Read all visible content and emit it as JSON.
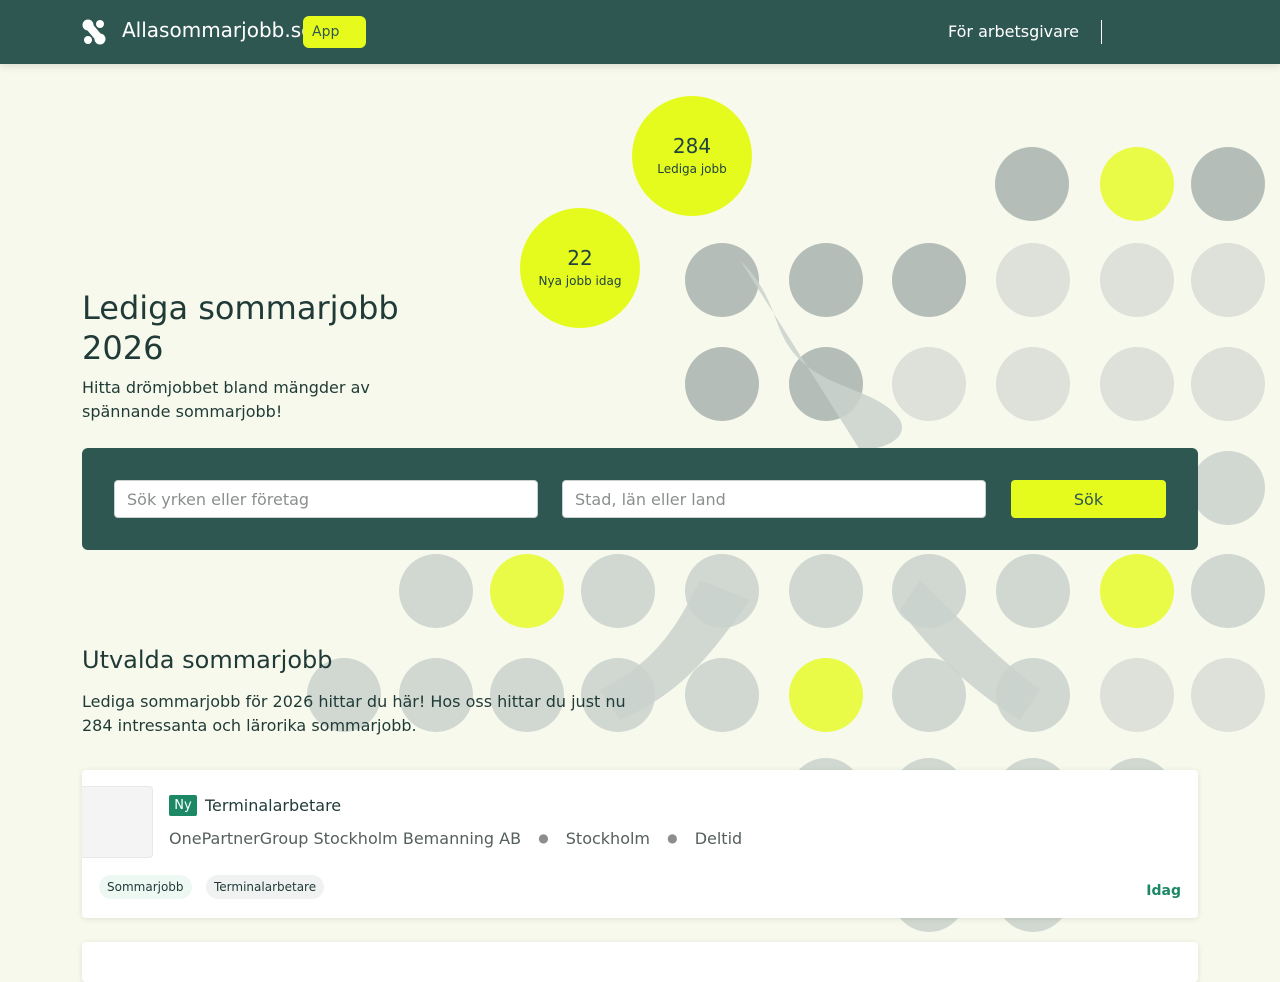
{
  "header": {
    "logo_text": "Allasommarjobb.se",
    "app_badge": "App",
    "employer_link": "För arbetsgivare"
  },
  "stats": [
    {
      "value": "284",
      "label": "Lediga jobb"
    },
    {
      "value": "22",
      "label": "Nya jobb idag"
    }
  ],
  "hero": {
    "title": "Lediga sommarjobb 2026",
    "subtitle": "Hitta drömjobbet bland mängder av spännande sommarjobb!"
  },
  "search": {
    "query_placeholder": "Sök yrken eller företag",
    "location_placeholder": "Stad, län eller land",
    "button_label": "Sök"
  },
  "featured": {
    "title": "Utvalda sommarjobb",
    "description": "Lediga sommarjobb för 2026 hittar du här! Hos oss hittar du just nu 284 intressanta och lärorika sommarjobb."
  },
  "jobs": [
    {
      "badge": "Ny",
      "title": "Terminalarbetare",
      "company": "OnePartnerGroup Stockholm Bemanning AB",
      "location": "Stockholm",
      "employment_type": "Deltid",
      "tags": [
        "Sommarjobb",
        "Terminalarbetare"
      ],
      "posted": "Idag"
    }
  ],
  "colors": {
    "header_bg": "#2f5752",
    "accent_yellow": "#e5fb1d",
    "page_bg": "#f7f9ec",
    "badge_green": "#1d8866"
  },
  "icons": {
    "logo": "clover-logo-icon"
  }
}
